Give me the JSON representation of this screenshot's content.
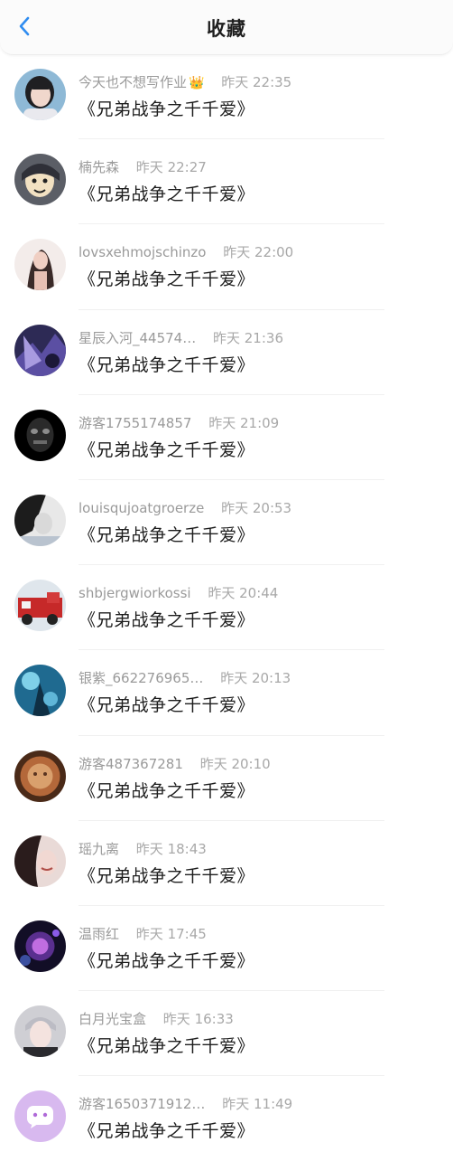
{
  "header": {
    "title": "收藏",
    "back_icon": "chevron-left-icon",
    "accent": "#2f8cf0"
  },
  "items": [
    {
      "name": "今天也不想写作业",
      "badge": "👑",
      "time": "昨天 22:35",
      "title": "《兄弟战争之千千爱》"
    },
    {
      "name": "楠先森",
      "time": "昨天 22:27",
      "title": "《兄弟战争之千千爱》"
    },
    {
      "name": "lovsxehmojschinzo",
      "time": "昨天 22:00",
      "title": "《兄弟战争之千千爱》"
    },
    {
      "name": "星辰入河_44574…",
      "time": "昨天 21:36",
      "title": "《兄弟战争之千千爱》"
    },
    {
      "name": "游客1755174857",
      "time": "昨天 21:09",
      "title": "《兄弟战争之千千爱》"
    },
    {
      "name": "louisqujoatgroerze",
      "time": "昨天 20:53",
      "title": "《兄弟战争之千千爱》"
    },
    {
      "name": "shbjergwiorkossi",
      "time": "昨天 20:44",
      "title": "《兄弟战争之千千爱》"
    },
    {
      "name": "银紫_662276965…",
      "time": "昨天 20:13",
      "title": "《兄弟战争之千千爱》"
    },
    {
      "name": "游客487367281",
      "time": "昨天 20:10",
      "title": "《兄弟战争之千千爱》"
    },
    {
      "name": "瑶九离",
      "time": "昨天 18:43",
      "title": "《兄弟战争之千千爱》"
    },
    {
      "name": "温雨红",
      "time": "昨天 17:45",
      "title": "《兄弟战争之千千爱》"
    },
    {
      "name": "白月光宝盒",
      "time": "昨天 16:33",
      "title": "《兄弟战争之千千爱》"
    },
    {
      "name": "游客1650371912…",
      "time": "昨天 11:49",
      "title": "《兄弟战争之千千爱》"
    }
  ]
}
